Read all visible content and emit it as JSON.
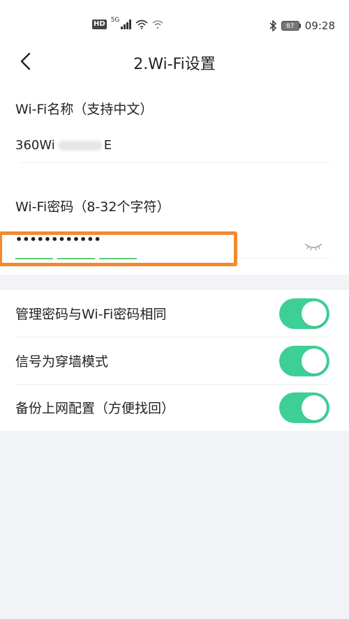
{
  "status_bar": {
    "hd": "HD",
    "network": "5G",
    "time": "09:28",
    "battery": "87"
  },
  "header": {
    "title": "2.Wi-Fi设置"
  },
  "form": {
    "ssid_label": "Wi-Fi名称（支持中文）",
    "ssid_value_prefix": "360Wi",
    "ssid_value_suffix": "E",
    "password_label": "Wi-Fi密码（8-32个字符）",
    "password_value": "••••••••••••"
  },
  "toggles": [
    {
      "label": "管理密码与Wi-Fi密码相同",
      "on": true
    },
    {
      "label": "信号为穿墙模式",
      "on": true
    },
    {
      "label": "备份上网配置（方便找回）",
      "on": true
    }
  ],
  "colors": {
    "accent": "#3ecf97",
    "highlight": "#f28a2e",
    "strength": "#5cc97b",
    "background": "#f2f3f6"
  }
}
